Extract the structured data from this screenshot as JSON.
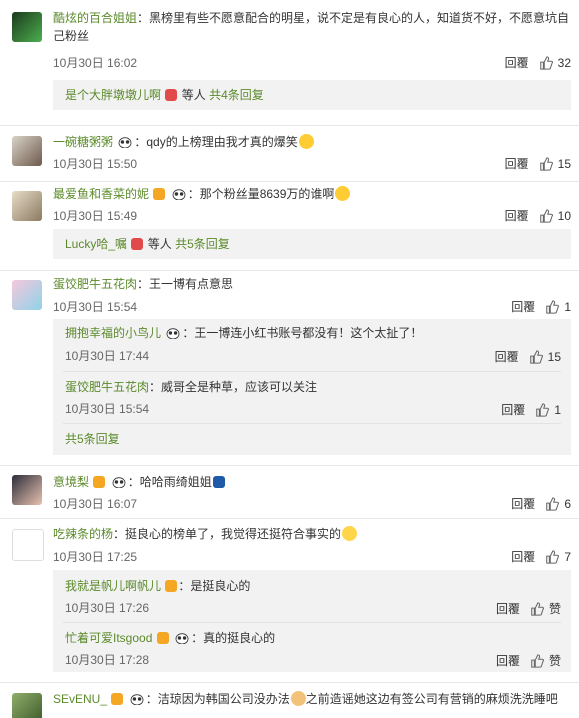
{
  "comments": [
    {
      "user": "酷炫的百合姐姐",
      "text": "：黑榜里有些不愿意配合的明星，说不定是有良心的人，知道货不好，不愿意坑自",
      "text2": "己粉丝",
      "time": "10月30日 16:02",
      "reply": "回覆",
      "likes": "32"
    },
    {
      "more": "是个大胖墩墩儿啊",
      "more_tail": "等人",
      "more_count": "共4条回复"
    },
    {
      "user": "一碗糖粥粥",
      "text": "：qdy的上榜理由我才真的爆笑",
      "time": "10月30日 15:50",
      "reply": "回覆",
      "likes": "15"
    },
    {
      "user": "最爱鱼和香菜的妮",
      "text": "：那个粉丝量8639万的谁啊",
      "time": "10月30日 15:49",
      "reply": "回覆",
      "likes": "10"
    },
    {
      "more": "Lucky哈_嘱",
      "more_tail": "等人",
      "more_count": "共5条回复"
    },
    {
      "user": "蛋饺肥牛五花肉",
      "text": "：王一博有点意思",
      "time": "10月30日 15:54",
      "reply": "回覆",
      "likes": "1"
    },
    {
      "sub_user": "拥抱幸福的小鸟儿",
      "sub_text": "：王一博连小红书账号都没有！这个太扯了！",
      "sub_time": "10月30日 17:44",
      "sub_reply": "回覆",
      "sub_likes": "15"
    },
    {
      "sub_user": "蛋饺肥牛五花肉",
      "sub_text": "：威哥全是种草，应该可以关注",
      "sub_time": "10月30日 15:54",
      "sub_reply": "回覆",
      "sub_likes": "1"
    },
    {
      "more_count": "共5条回复"
    },
    {
      "user": "意境梨",
      "text": "：哈哈雨绮姐姐",
      "time": "10月30日 16:07",
      "reply": "回覆",
      "likes": "6"
    },
    {
      "user": "吃辣条的杨",
      "text": "：挺良心的榜单了，我觉得还挺符合事实的",
      "time": "10月30日 17:25",
      "reply": "回覆",
      "likes": "7"
    },
    {
      "sub_user": "我就是帆儿啊帆儿",
      "sub_text": "：是挺良心的",
      "sub_time": "10月30日 17:26",
      "sub_reply": "回覆",
      "sub_likes": "赞"
    },
    {
      "sub_user": "忙着可爱Itsgood",
      "sub_text": "：真的挺良心的",
      "sub_time": "10月30日 17:28",
      "sub_reply": "回覆",
      "sub_likes": "赞"
    },
    {
      "user": "SEvENU_",
      "text": "：洁琼因为韩国公司没办法",
      "text_b": "之前造谣她这边有签公司有营销的麻烦洗洗睡吧"
    }
  ],
  "colors": {
    "username": "#5b8a2b",
    "subbox": "#f2f2f2",
    "divider": "#e6e6e6",
    "badge_red": "#e14a4a",
    "badge_orange": "#f5a623"
  },
  "icons": {
    "like": "thumbs-up-icon",
    "face": "panda-face-icon",
    "badge": "user-badge-icon"
  }
}
